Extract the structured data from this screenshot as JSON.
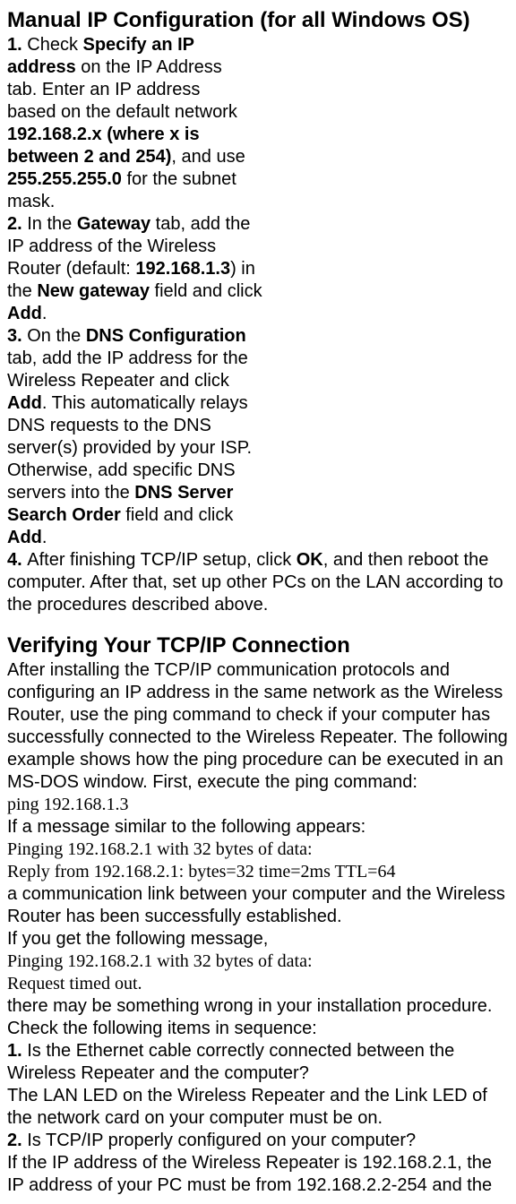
{
  "h1": "Manual IP Configuration (for all Windows OS)",
  "s1_num": "1. ",
  "s1_a": "Check ",
  "s1_b": "Specify an IP address",
  "s1_c": " on the IP Address tab. Enter an IP address based on the default network ",
  "s1_d": "192.168.2.x (where x is between 2 and 254)",
  "s1_e": ", and use ",
  "s1_f": "255.255.255.0",
  "s1_g": " for the subnet mask.",
  "s2_num": "2. ",
  "s2_a": "In the ",
  "s2_b": "Gateway",
  "s2_c": " tab, add the IP address of the Wireless Router (default: ",
  "s2_d": "192.168.1.3",
  "s2_e": ") in the ",
  "s2_f": "New gateway",
  "s2_g": " field and click ",
  "s2_h": "Add",
  "s2_i": ".",
  "s3_num": "3. ",
  "s3_a": "On the ",
  "s3_b": "DNS Configuration",
  "s3_c": " tab, add the IP address for the Wireless Repeater and click ",
  "s3_d": "Add",
  "s3_e": ". This automatically relays DNS requests to the DNS server(s) provided by your ISP. Otherwise, add specific DNS servers into the ",
  "s3_f": "DNS Server Search Order",
  "s3_g": " field and click ",
  "s3_h": "Add",
  "s3_i": ".",
  "s4_num": "4. ",
  "s4_a": "After finishing TCP/IP setup, click ",
  "s4_b": "OK",
  "s4_c": ", and then reboot the computer. After that, set up other PCs on the LAN according to the procedures described above.",
  "h2": "Verifying Your TCP/IP Connection",
  "v1": "After installing the TCP/IP communication protocols and configuring an IP address in the same network as the Wireless Router, use the ping command to check if your computer has successfully connected to the Wireless Repeater. The following example shows how the ping procedure can be executed in an MS-DOS window. First, execute the ping command:",
  "cmd1": "ping 192.168.1.3",
  "v2": "If a message similar to the following appears:",
  "out1": "Pinging 192.168.2.1 with 32 bytes of data:",
  "out2": "Reply from 192.168.2.1: bytes=32 time=2ms TTL=64",
  "v3": "a communication link between your computer and the Wireless Router has been successfully established.",
  "v4": "If you get the following message,",
  "out3": "Pinging 192.168.2.1 with 32 bytes of data:",
  "out4": "Request timed out.",
  "v5": "there may be something wrong in your installation procedure. Check the following items in sequence:",
  "c1_num": "1. ",
  "c1": "Is the Ethernet cable correctly connected between the Wireless Repeater and the computer?",
  "c1_note": "The LAN LED on the Wireless Repeater and the Link LED of the network card on your computer must be on.",
  "c2_num": "2. ",
  "c2": "Is TCP/IP properly configured on your computer?",
  "c2_note": "If the IP address of the Wireless Repeater is 192.168.2.1, the IP address of your PC must be from 192.168.2.2-254 and the"
}
